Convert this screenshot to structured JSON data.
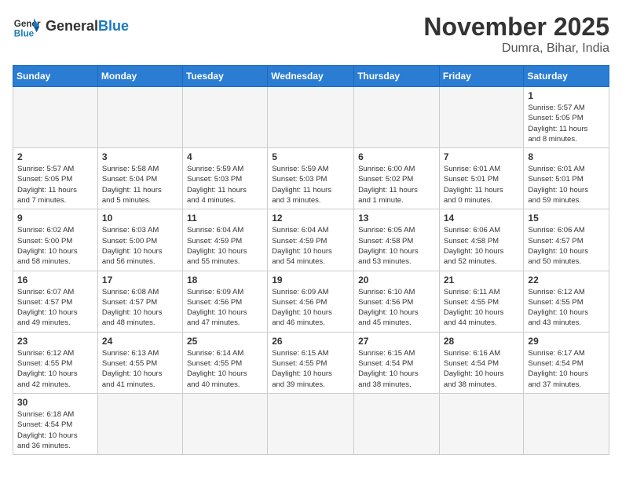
{
  "header": {
    "logo_general": "General",
    "logo_blue": "Blue",
    "month_title": "November 2025",
    "location": "Dumra, Bihar, India"
  },
  "weekdays": [
    "Sunday",
    "Monday",
    "Tuesday",
    "Wednesday",
    "Thursday",
    "Friday",
    "Saturday"
  ],
  "days": [
    {
      "date": "",
      "info": ""
    },
    {
      "date": "",
      "info": ""
    },
    {
      "date": "",
      "info": ""
    },
    {
      "date": "",
      "info": ""
    },
    {
      "date": "",
      "info": ""
    },
    {
      "date": "",
      "info": ""
    },
    {
      "date": "1",
      "info": "Sunrise: 5:57 AM\nSunset: 5:05 PM\nDaylight: 11 hours\nand 8 minutes."
    },
    {
      "date": "2",
      "info": "Sunrise: 5:57 AM\nSunset: 5:05 PM\nDaylight: 11 hours\nand 7 minutes."
    },
    {
      "date": "3",
      "info": "Sunrise: 5:58 AM\nSunset: 5:04 PM\nDaylight: 11 hours\nand 5 minutes."
    },
    {
      "date": "4",
      "info": "Sunrise: 5:59 AM\nSunset: 5:03 PM\nDaylight: 11 hours\nand 4 minutes."
    },
    {
      "date": "5",
      "info": "Sunrise: 5:59 AM\nSunset: 5:03 PM\nDaylight: 11 hours\nand 3 minutes."
    },
    {
      "date": "6",
      "info": "Sunrise: 6:00 AM\nSunset: 5:02 PM\nDaylight: 11 hours\nand 1 minute."
    },
    {
      "date": "7",
      "info": "Sunrise: 6:01 AM\nSunset: 5:01 PM\nDaylight: 11 hours\nand 0 minutes."
    },
    {
      "date": "8",
      "info": "Sunrise: 6:01 AM\nSunset: 5:01 PM\nDaylight: 10 hours\nand 59 minutes."
    },
    {
      "date": "9",
      "info": "Sunrise: 6:02 AM\nSunset: 5:00 PM\nDaylight: 10 hours\nand 58 minutes."
    },
    {
      "date": "10",
      "info": "Sunrise: 6:03 AM\nSunset: 5:00 PM\nDaylight: 10 hours\nand 56 minutes."
    },
    {
      "date": "11",
      "info": "Sunrise: 6:04 AM\nSunset: 4:59 PM\nDaylight: 10 hours\nand 55 minutes."
    },
    {
      "date": "12",
      "info": "Sunrise: 6:04 AM\nSunset: 4:59 PM\nDaylight: 10 hours\nand 54 minutes."
    },
    {
      "date": "13",
      "info": "Sunrise: 6:05 AM\nSunset: 4:58 PM\nDaylight: 10 hours\nand 53 minutes."
    },
    {
      "date": "14",
      "info": "Sunrise: 6:06 AM\nSunset: 4:58 PM\nDaylight: 10 hours\nand 52 minutes."
    },
    {
      "date": "15",
      "info": "Sunrise: 6:06 AM\nSunset: 4:57 PM\nDaylight: 10 hours\nand 50 minutes."
    },
    {
      "date": "16",
      "info": "Sunrise: 6:07 AM\nSunset: 4:57 PM\nDaylight: 10 hours\nand 49 minutes."
    },
    {
      "date": "17",
      "info": "Sunrise: 6:08 AM\nSunset: 4:57 PM\nDaylight: 10 hours\nand 48 minutes."
    },
    {
      "date": "18",
      "info": "Sunrise: 6:09 AM\nSunset: 4:56 PM\nDaylight: 10 hours\nand 47 minutes."
    },
    {
      "date": "19",
      "info": "Sunrise: 6:09 AM\nSunset: 4:56 PM\nDaylight: 10 hours\nand 46 minutes."
    },
    {
      "date": "20",
      "info": "Sunrise: 6:10 AM\nSunset: 4:56 PM\nDaylight: 10 hours\nand 45 minutes."
    },
    {
      "date": "21",
      "info": "Sunrise: 6:11 AM\nSunset: 4:55 PM\nDaylight: 10 hours\nand 44 minutes."
    },
    {
      "date": "22",
      "info": "Sunrise: 6:12 AM\nSunset: 4:55 PM\nDaylight: 10 hours\nand 43 minutes."
    },
    {
      "date": "23",
      "info": "Sunrise: 6:12 AM\nSunset: 4:55 PM\nDaylight: 10 hours\nand 42 minutes."
    },
    {
      "date": "24",
      "info": "Sunrise: 6:13 AM\nSunset: 4:55 PM\nDaylight: 10 hours\nand 41 minutes."
    },
    {
      "date": "25",
      "info": "Sunrise: 6:14 AM\nSunset: 4:55 PM\nDaylight: 10 hours\nand 40 minutes."
    },
    {
      "date": "26",
      "info": "Sunrise: 6:15 AM\nSunset: 4:55 PM\nDaylight: 10 hours\nand 39 minutes."
    },
    {
      "date": "27",
      "info": "Sunrise: 6:15 AM\nSunset: 4:54 PM\nDaylight: 10 hours\nand 38 minutes."
    },
    {
      "date": "28",
      "info": "Sunrise: 6:16 AM\nSunset: 4:54 PM\nDaylight: 10 hours\nand 38 minutes."
    },
    {
      "date": "29",
      "info": "Sunrise: 6:17 AM\nSunset: 4:54 PM\nDaylight: 10 hours\nand 37 minutes."
    },
    {
      "date": "30",
      "info": "Sunrise: 6:18 AM\nSunset: 4:54 PM\nDaylight: 10 hours\nand 36 minutes."
    },
    {
      "date": "",
      "info": ""
    },
    {
      "date": "",
      "info": ""
    },
    {
      "date": "",
      "info": ""
    },
    {
      "date": "",
      "info": ""
    },
    {
      "date": "",
      "info": ""
    },
    {
      "date": "",
      "info": ""
    }
  ]
}
